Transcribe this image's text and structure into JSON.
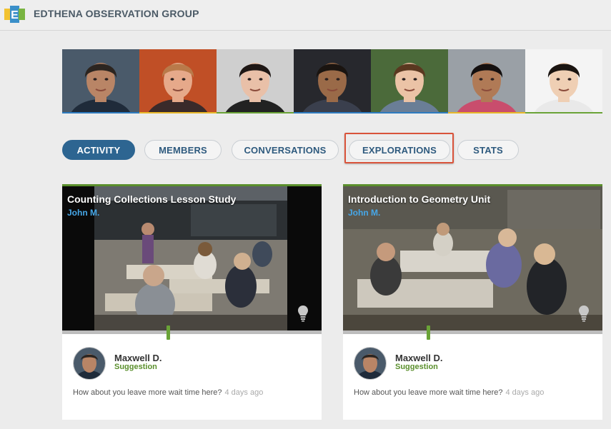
{
  "header": {
    "brand": "EDTHENA OBSERVATION GROUP",
    "logo_icon": "edthena-logo-icon"
  },
  "members": [
    {
      "skin": "#b98566",
      "hair": "#2c2520",
      "bg": "#4a5a6a",
      "shirt": "#1f2b3a",
      "bar": "#2e7cc0"
    },
    {
      "skin": "#e6a98a",
      "hair": "#b97a4a",
      "bg": "#c04f26",
      "shirt": "#3a2a2a",
      "bar": "#e8b82a"
    },
    {
      "skin": "#e9c0a8",
      "hair": "#1e1715",
      "bg": "#cfcfcf",
      "shirt": "#222222",
      "bar": "#6aa337"
    },
    {
      "skin": "#9a6a48",
      "hair": "#1a1410",
      "bg": "#27282d",
      "shirt": "#3a3f4d",
      "bar": "#2e7cc0"
    },
    {
      "skin": "#ebc3a6",
      "hair": "#5a3820",
      "bg": "#4b6a3a",
      "shirt": "#6a7e96",
      "bar": "#2e7cc0"
    },
    {
      "skin": "#b07a56",
      "hair": "#141010",
      "bg": "#9aa0a6",
      "shirt": "#c94d6d",
      "bar": "#e8b82a"
    },
    {
      "skin": "#efcfb4",
      "hair": "#1a1410",
      "bg": "#f4f4f4",
      "shirt": "#e9e9e9",
      "bar": "#6aa337"
    }
  ],
  "tabs": [
    {
      "label": "ACTIVITY",
      "active": true
    },
    {
      "label": "MEMBERS",
      "active": false
    },
    {
      "label": "CONVERSATIONS",
      "active": false
    },
    {
      "label": "EXPLORATIONS",
      "active": false
    },
    {
      "label": "STATS",
      "active": false
    }
  ],
  "cards": [
    {
      "title": "Counting Collections Lesson Study",
      "author": "John M.",
      "comment": {
        "name": "Maxwell D.",
        "type": "Suggestion",
        "text": "How about you leave more wait time here?",
        "time": "4 days ago"
      }
    },
    {
      "title": "Introduction to Geometry Unit",
      "author": "John M.",
      "comment": {
        "name": "Maxwell D.",
        "type": "Suggestion",
        "text": "How about you leave more wait time here?",
        "time": "4 days ago"
      }
    }
  ],
  "colors": {
    "accent_blue": "#2d6591",
    "highlight_red": "#d9533a",
    "green": "#5a8f2c",
    "author_blue": "#46a7e8"
  }
}
